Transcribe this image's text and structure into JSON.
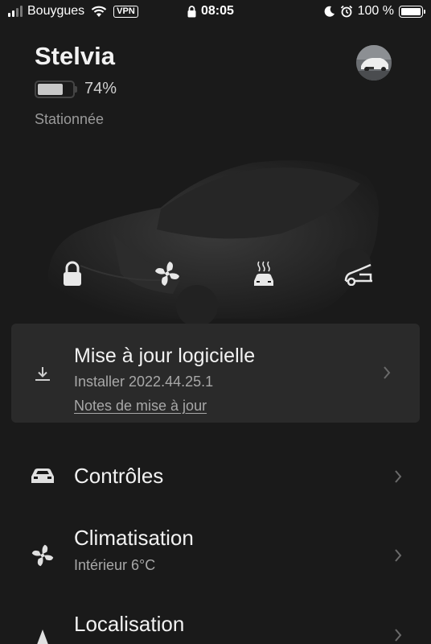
{
  "status_bar": {
    "carrier": "Bouygues",
    "vpn": "VPN",
    "time": "08:05",
    "battery": "100 %"
  },
  "vehicle": {
    "name": "Stelvia",
    "charge_level": 0.74,
    "charge_text": "74%",
    "status": "Stationnée"
  },
  "quick_controls": [
    {
      "icon": "lock-icon"
    },
    {
      "icon": "fan-icon"
    },
    {
      "icon": "seat-heater-icon"
    },
    {
      "icon": "frunk-open-icon"
    }
  ],
  "update": {
    "title": "Mise à jour logicielle",
    "subtitle": "Installer 2022.44.25.1",
    "notes_link": "Notes de mise à jour"
  },
  "menu": {
    "controls": {
      "title": "Contrôles"
    },
    "climate": {
      "title": "Climatisation",
      "subtitle": "Intérieur 6°C"
    },
    "location": {
      "title": "Localisation"
    }
  }
}
